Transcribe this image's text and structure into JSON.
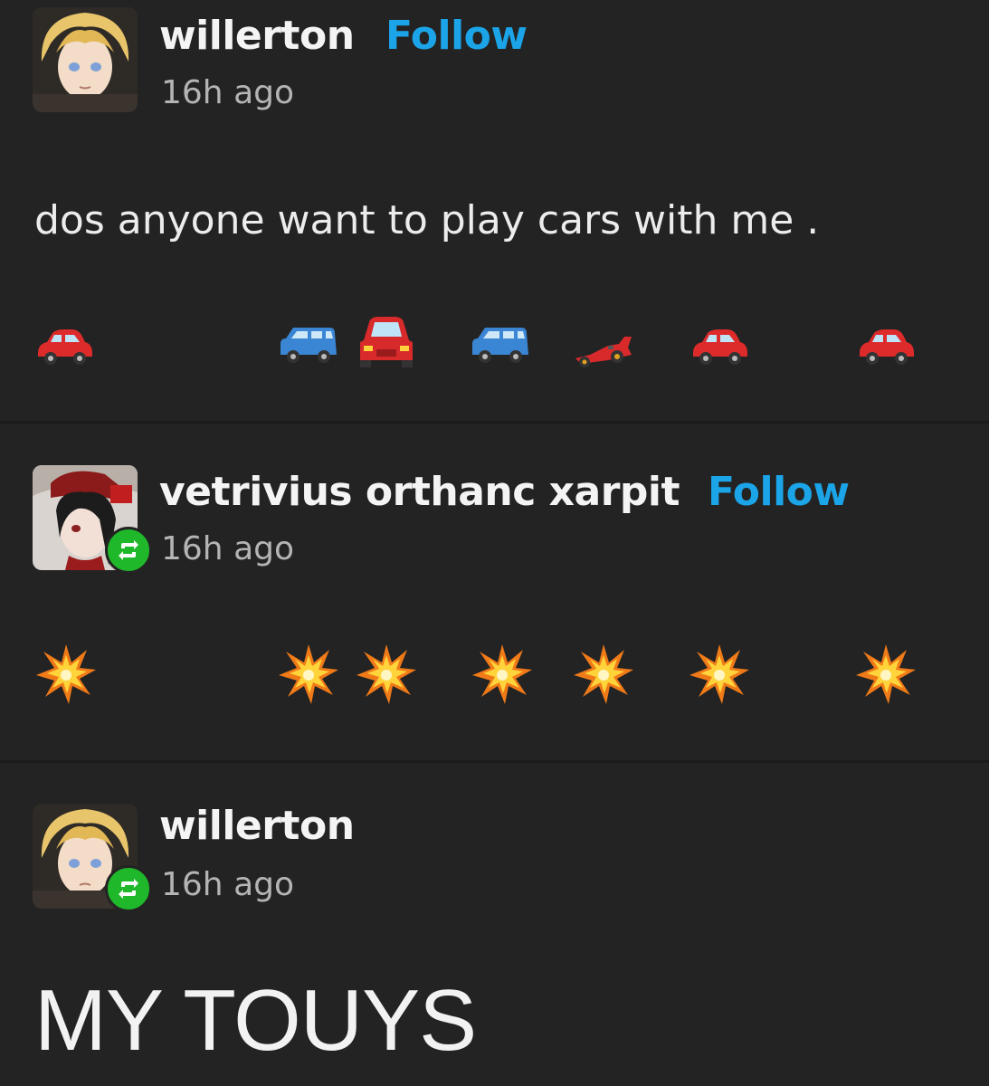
{
  "posts": [
    {
      "username": "willerton",
      "follow_label": "Follow",
      "time": "16h ago",
      "text": "dos anyone want to play cars with me .",
      "emojis": [
        "red-car-icon",
        "blue-suv-icon",
        "red-car-front-icon",
        "blue-suv-icon",
        "racing-car-icon",
        "red-car-icon",
        "red-car-icon"
      ]
    },
    {
      "username": "vetrivius orthanc xarpit",
      "follow_label": "Follow",
      "time": "16h ago",
      "reblog": true,
      "emojis": [
        "collision-icon",
        "collision-icon",
        "collision-icon",
        "collision-icon",
        "collision-icon",
        "collision-icon",
        "collision-icon"
      ]
    },
    {
      "username": "willerton",
      "time": "16h ago",
      "reblog": true,
      "text": "MY TOUYS"
    }
  ],
  "colors": {
    "background": "#232323",
    "follow": "#1ba4e8",
    "reblog_badge": "#1fb82b"
  }
}
